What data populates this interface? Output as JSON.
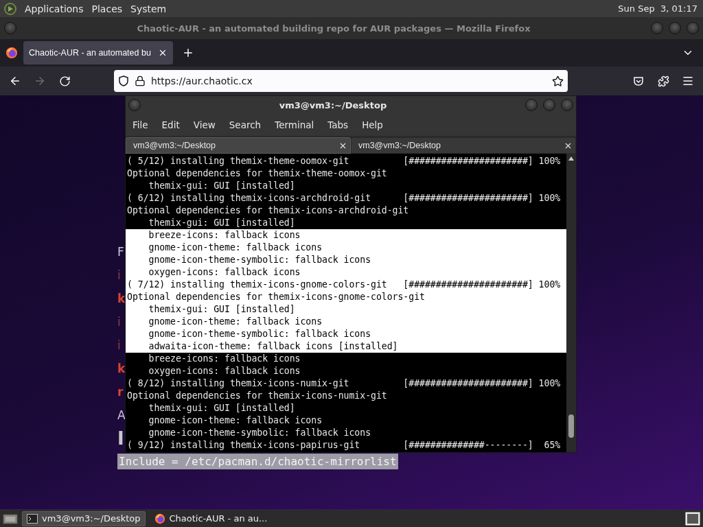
{
  "top_panel": {
    "menus": [
      "Applications",
      "Places",
      "System"
    ],
    "clock": "Sun Sep  3, 01:17"
  },
  "browser": {
    "title": "Chaotic-AUR - an automated building repo for AUR packages — Mozilla Firefox",
    "tabs": [
      {
        "label": "Chaotic-AUR - an automated bu",
        "selected": true
      }
    ],
    "url": "https://aur.chaotic.cx",
    "page_fragments": [
      {
        "text": "F",
        "kind": "plain"
      },
      {
        "text": "i",
        "kind": "red"
      },
      {
        "text": "k",
        "kind": "red-bold"
      },
      {
        "text": "i",
        "kind": "red"
      },
      {
        "text": "i",
        "kind": "red"
      },
      {
        "text": "k",
        "kind": "red-bold"
      },
      {
        "text": "r",
        "kind": "red-bold"
      },
      {
        "text": "A",
        "kind": "plain"
      },
      {
        "text": "I",
        "kind": "big"
      },
      {
        "text": "Include = /etc/pacman.d/chaotic-mirrorlist",
        "kind": "highlight"
      }
    ]
  },
  "terminal": {
    "title": "vm3@vm3:~/Desktop",
    "menus": [
      "File",
      "Edit",
      "View",
      "Search",
      "Terminal",
      "Tabs",
      "Help"
    ],
    "tabs": [
      {
        "label": "vm3@vm3:~/Desktop",
        "selected": true
      },
      {
        "label": "vm3@vm3:~/Desktop",
        "selected": false
      }
    ],
    "lines": [
      {
        "text": "( 5/12) installing themix-theme-oomox-git          [######################] 100%",
        "selected": false
      },
      {
        "text": "Optional dependencies for themix-theme-oomox-git",
        "selected": false
      },
      {
        "text": "    themix-gui: GUI [installed]",
        "selected": false
      },
      {
        "text": "( 6/12) installing themix-icons-archdroid-git      [######################] 100%",
        "selected": false
      },
      {
        "text": "Optional dependencies for themix-icons-archdroid-git",
        "selected": false
      },
      {
        "text": "    themix-gui: GUI [installed]",
        "selected": false
      },
      {
        "text": "    breeze-icons: fallback icons",
        "selected": true
      },
      {
        "text": "    gnome-icon-theme: fallback icons",
        "selected": true
      },
      {
        "text": "    gnome-icon-theme-symbolic: fallback icons",
        "selected": true
      },
      {
        "text": "    oxygen-icons: fallback icons",
        "selected": true
      },
      {
        "text": "( 7/12) installing themix-icons-gnome-colors-git   [######################] 100%",
        "selected": true
      },
      {
        "text": "Optional dependencies for themix-icons-gnome-colors-git",
        "selected": true
      },
      {
        "text": "    themix-gui: GUI [installed]",
        "selected": true
      },
      {
        "text": "    gnome-icon-theme: fallback icons",
        "selected": true
      },
      {
        "text": "    gnome-icon-theme-symbolic: fallback icons",
        "selected": true
      },
      {
        "text": "    adwaita-icon-theme: fallback icons [installed]",
        "selected": true
      },
      {
        "text": "    breeze-icons: fallback icons",
        "selected": false
      },
      {
        "text": "    oxygen-icons: fallback icons",
        "selected": false
      },
      {
        "text": "( 8/12) installing themix-icons-numix-git          [######################] 100%",
        "selected": false
      },
      {
        "text": "Optional dependencies for themix-icons-numix-git",
        "selected": false
      },
      {
        "text": "    themix-gui: GUI [installed]",
        "selected": false
      },
      {
        "text": "    gnome-icon-theme: fallback icons",
        "selected": false
      },
      {
        "text": "    gnome-icon-theme-symbolic: fallback icons",
        "selected": false
      },
      {
        "text": "( 9/12) installing themix-icons-papirus-git        [##############--------]  65%",
        "selected": false
      }
    ]
  },
  "taskbar": {
    "tasks": [
      {
        "label": "vm3@vm3:~/Desktop",
        "kind": "terminal",
        "selected": true
      },
      {
        "label": "Chaotic-AUR - an au...",
        "kind": "browser",
        "selected": false
      }
    ]
  }
}
